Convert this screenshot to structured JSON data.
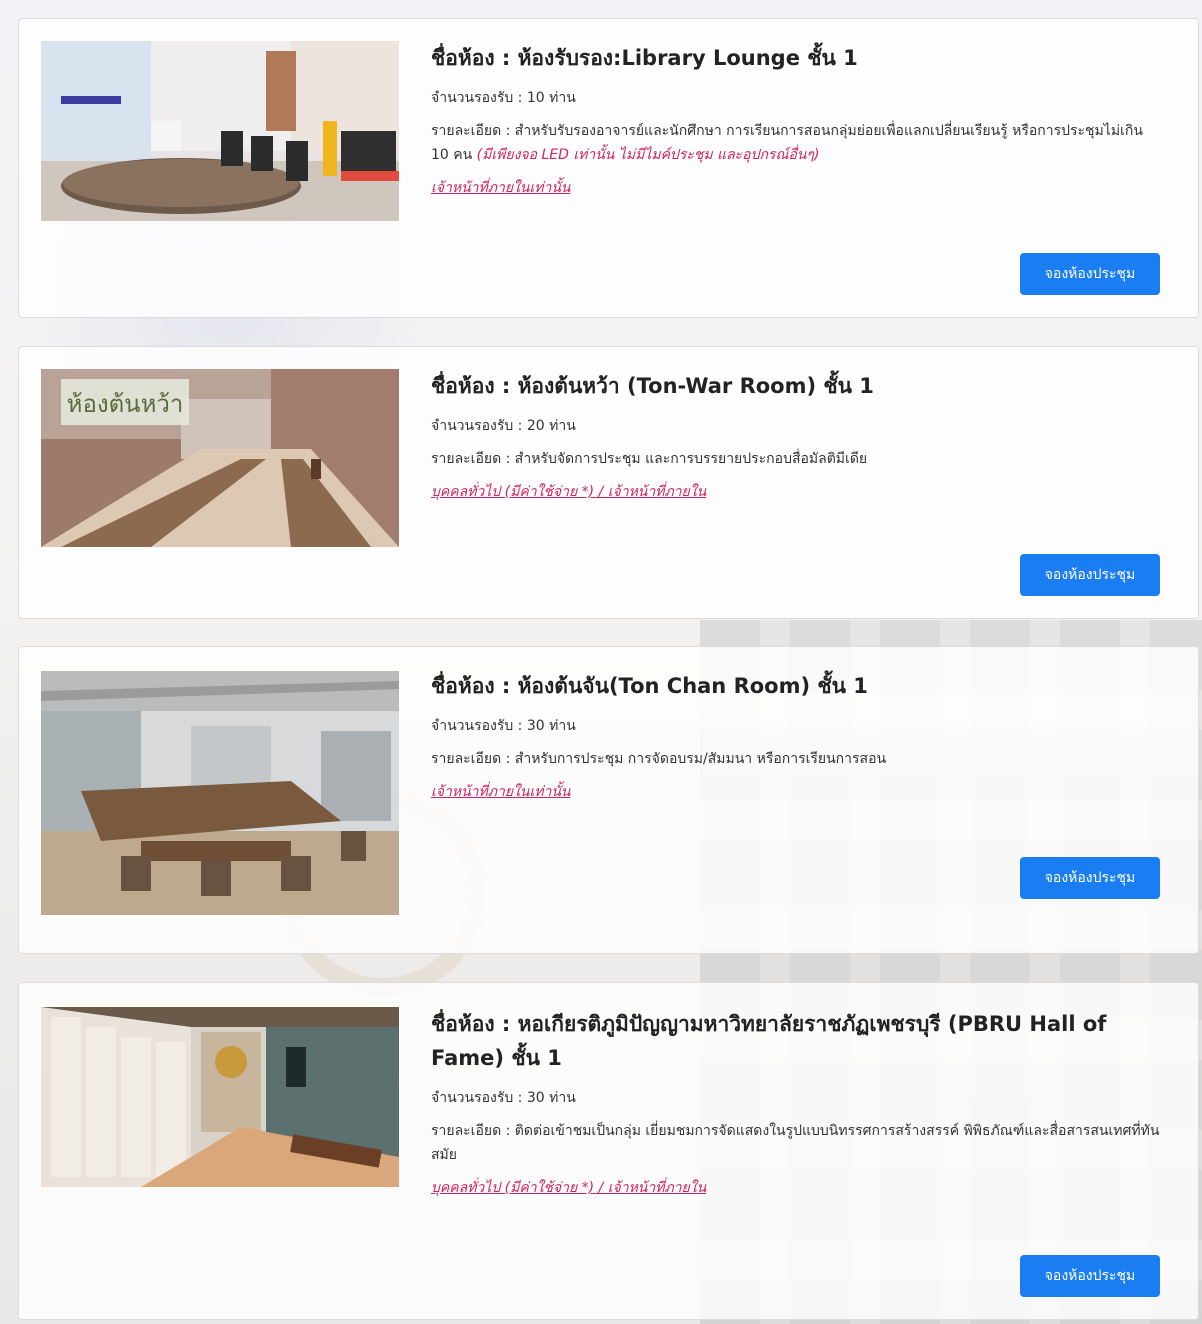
{
  "rooms": [
    {
      "title": "ชื่อห้อง : ห้องรับรอง:Library Lounge ชั้น 1",
      "capacity": "จำนวนรองรับ : 10 ท่าน",
      "detail": "รายละเอียด : สำหรับรับรองอาจารย์และนักศึกษา การเรียนการสอนกลุ่มย่อยเพื่อแลกเปลี่ยนเรียนรู้ หรือการประชุมไม่เกิน 10 คน",
      "detail_note": "(มีเพียงจอ LED เท่านั้น ไม่มีไมค์ประชุม และอุปกรณ์อื่นๆ)",
      "link": "เจ้าหน้าที่ภายในเท่านั้น",
      "button": "จองห้องประชุม"
    },
    {
      "title": "ชื่อห้อง : ห้องต้นหว้า (Ton-War Room) ชั้น 1",
      "capacity": "จำนวนรองรับ : 20 ท่าน",
      "detail": "รายละเอียด : สำหรับจัดการประชุม และการบรรยายประกอบสื่อมัลติมีเดีย",
      "detail_note": "",
      "link": "บุคคลทั่วไป (มีค่าใช้จ่าย *) / เจ้าหน้าที่ภายใน",
      "button": "จองห้องประชุม",
      "photo_sign": "ห้องต้นหว้า"
    },
    {
      "title": "ชื่อห้อง : ห้องต้นจัน(Ton Chan Room) ชั้น 1",
      "capacity": "จำนวนรองรับ : 30 ท่าน",
      "detail": "รายละเอียด : สำหรับการประชุม การจัดอบรม/สัมมนา หรือการเรียนการสอน",
      "detail_note": "",
      "link": "เจ้าหน้าที่ภายในเท่านั้น",
      "button": "จองห้องประชุม"
    },
    {
      "title": "ชื่อห้อง : หอเกียรติภูมิปัญญามหาวิทยาลัยราชภัฏเพชรบุรี (PBRU Hall of Fame) ชั้น 1",
      "capacity": "จำนวนรองรับ : 30 ท่าน",
      "detail": "รายละเอียด : ติดต่อเข้าชมเป็นกลุ่ม เยี่ยมชมการจัดแสดงในรูปแบบนิทรรศการสร้างสรรค์ พิพิธภัณฑ์และสื่อสารสนเทศที่ทันสมัย",
      "detail_note": "",
      "link": "บุคคลทั่วไป (มีค่าใช้จ่าย *) / เจ้าหน้าที่ภายใน",
      "button": "จองห้องประชุม"
    }
  ]
}
